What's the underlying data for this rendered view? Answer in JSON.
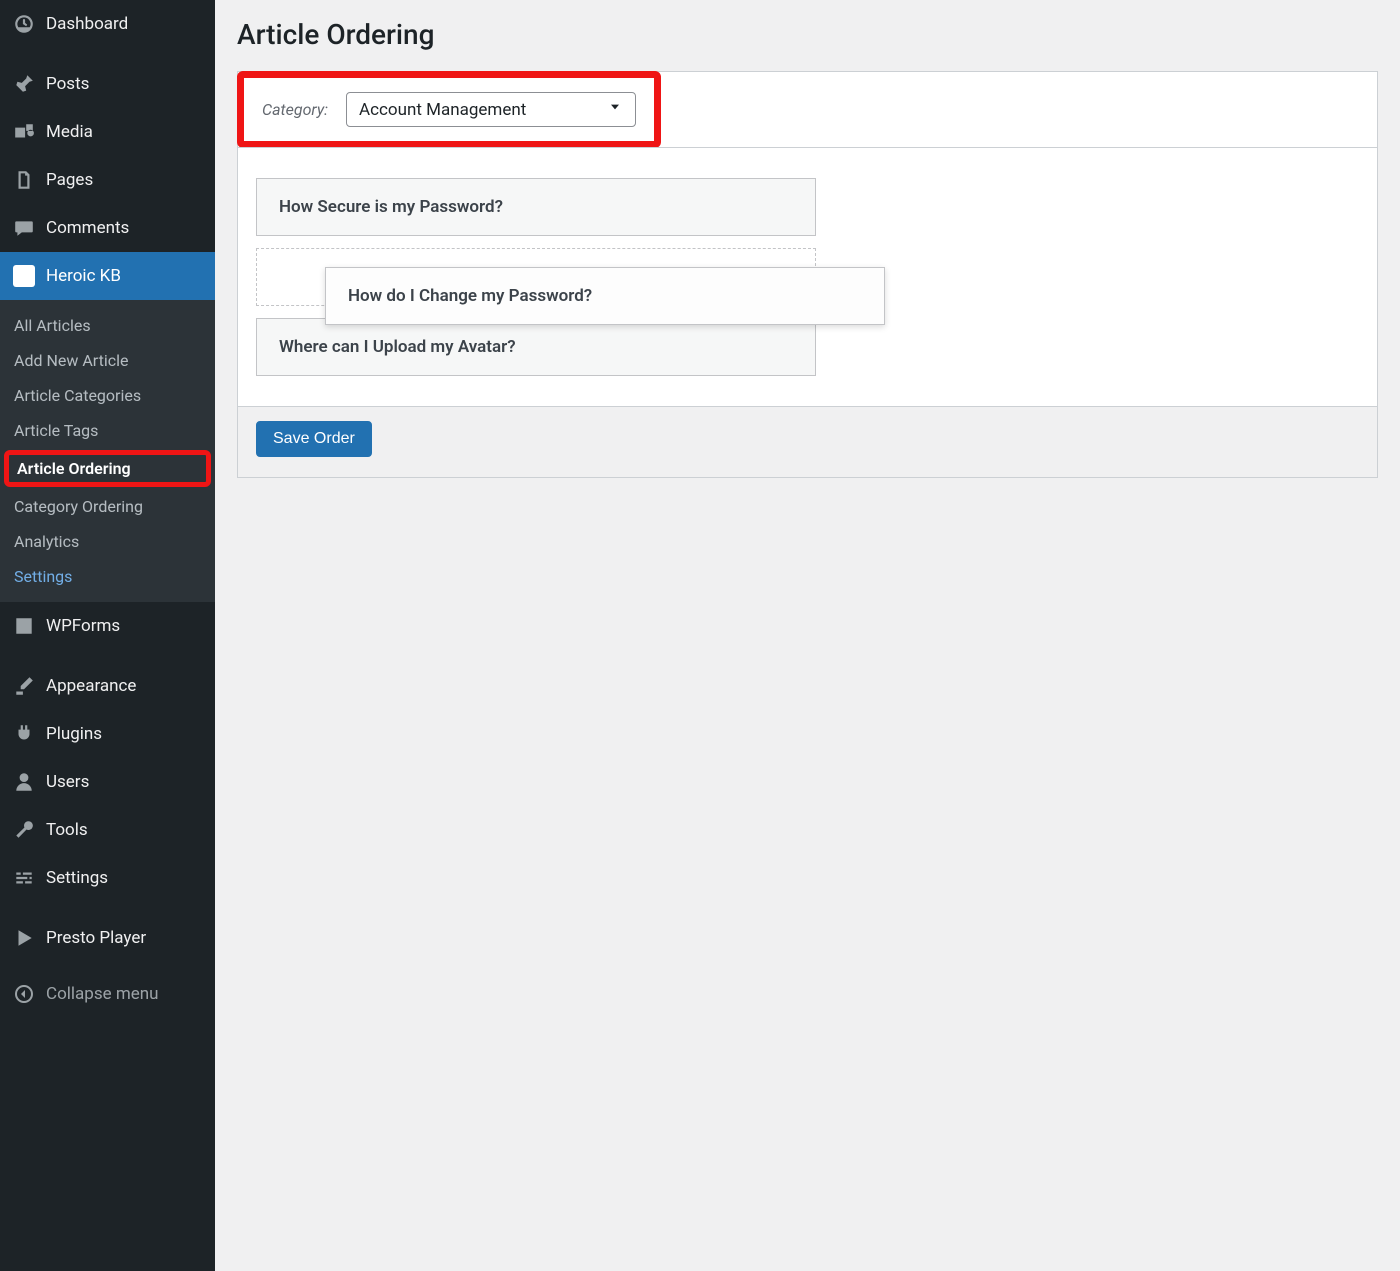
{
  "sidebar": {
    "dashboard": "Dashboard",
    "posts": "Posts",
    "media": "Media",
    "pages": "Pages",
    "comments": "Comments",
    "heroic_kb": "Heroic KB",
    "submenu": {
      "all_articles": "All Articles",
      "add_new": "Add New Article",
      "categories": "Article Categories",
      "tags": "Article Tags",
      "ordering": "Article Ordering",
      "cat_ordering": "Category Ordering",
      "analytics": "Analytics",
      "settings": "Settings"
    },
    "wpforms": "WPForms",
    "appearance": "Appearance",
    "plugins": "Plugins",
    "users": "Users",
    "tools": "Tools",
    "settings": "Settings",
    "presto": "Presto Player",
    "collapse": "Collapse menu"
  },
  "main": {
    "title": "Article Ordering",
    "category_label": "Category:",
    "category_value": "Account Management",
    "articles": {
      "row1": "How Secure is my Password?",
      "dragging": "How do I Change my Password?",
      "row3": "Where can I Upload my Avatar?"
    },
    "save_button": "Save Order"
  }
}
